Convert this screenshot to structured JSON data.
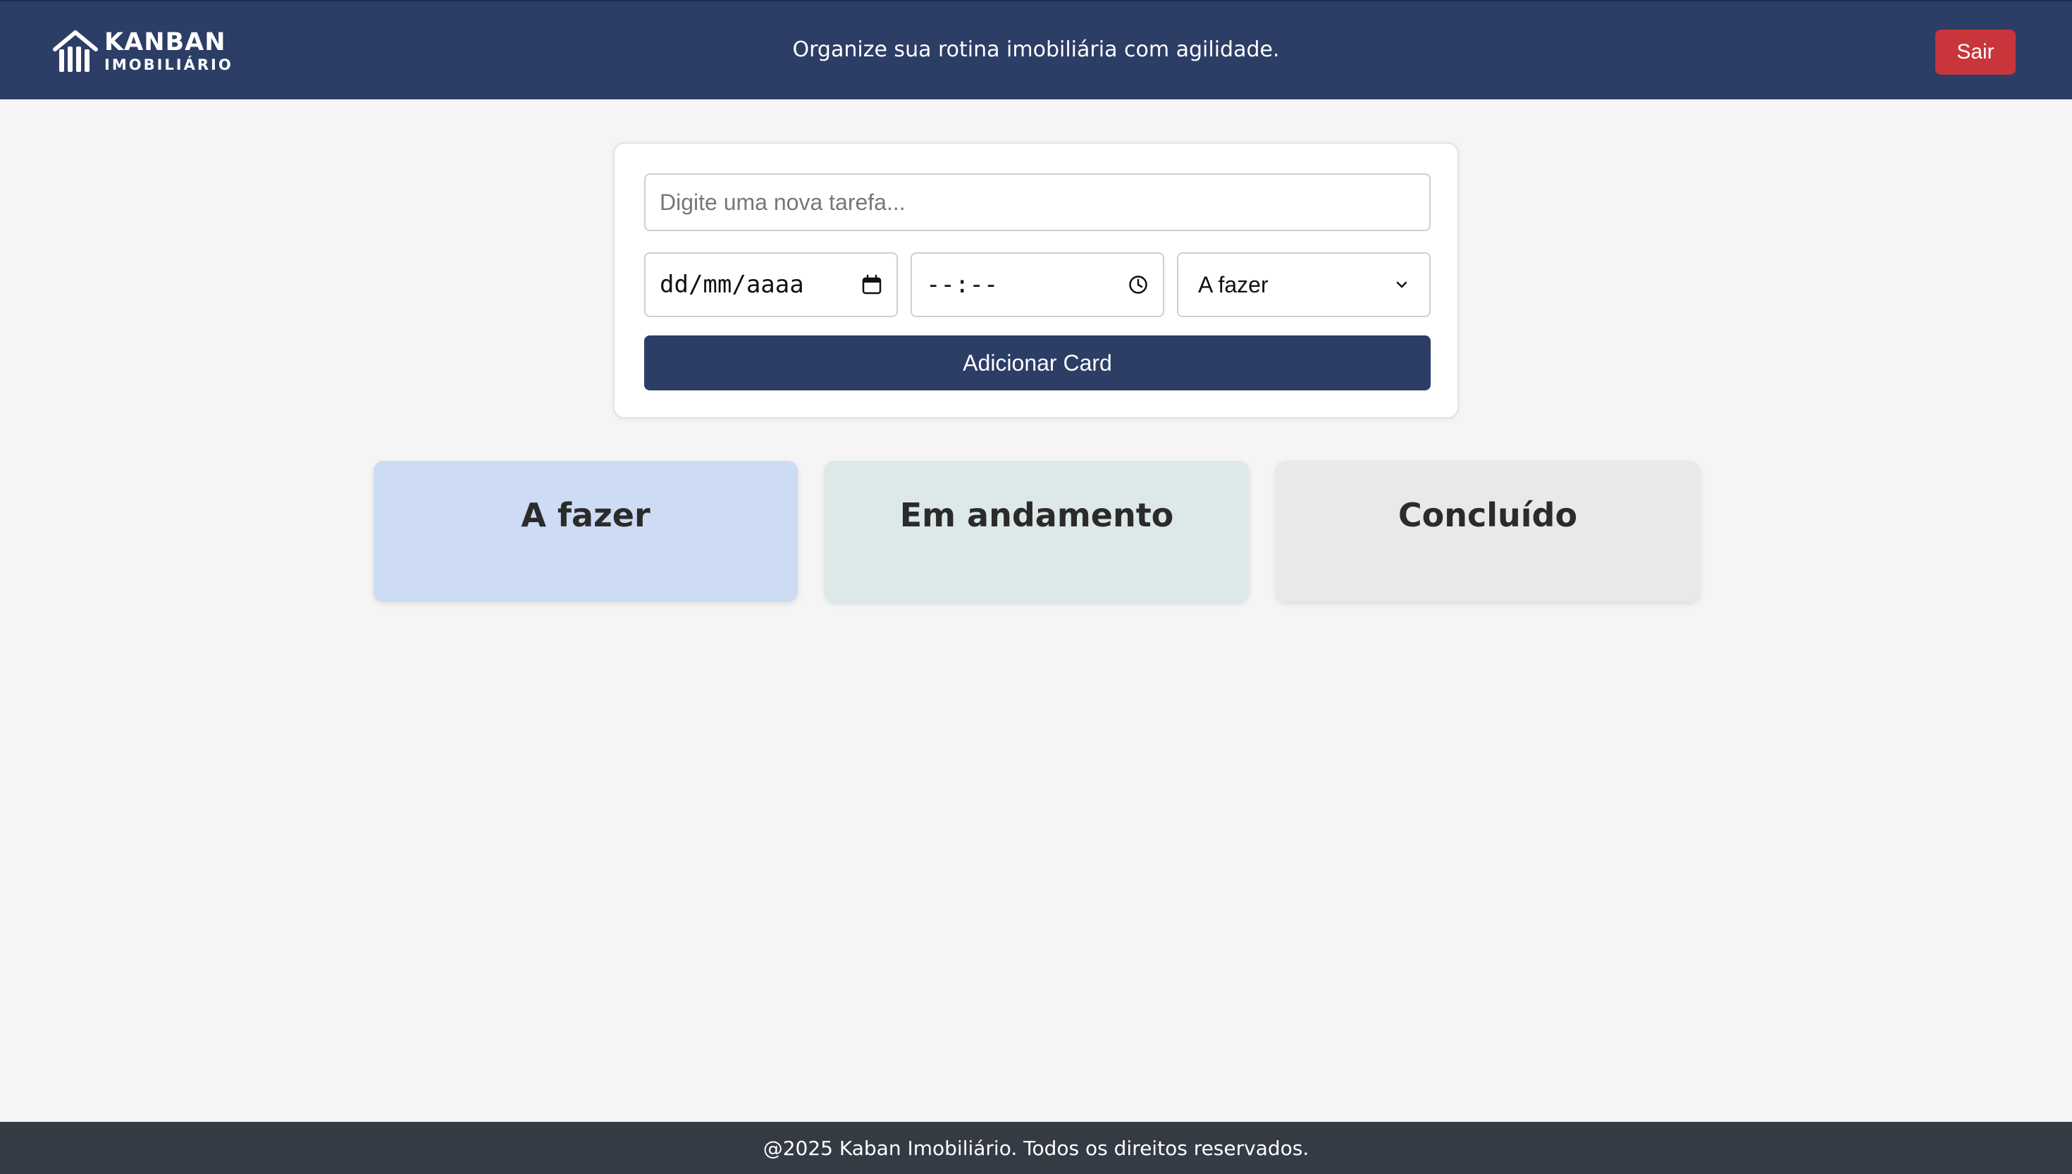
{
  "header": {
    "logo_main": "KANBAN",
    "logo_sub": "IMOBILIÁRIO",
    "logo_icon": "house-columns-icon",
    "tagline": "Organize sua rotina imobiliária com agilidade.",
    "logout_label": "Sair"
  },
  "form": {
    "task_placeholder": "Digite uma nova tarefa...",
    "task_value": "",
    "date_placeholder": "dd/mm/aaaa",
    "date_icon": "calendar-icon",
    "time_placeholder": "--:--",
    "time_icon": "clock-icon",
    "status_selected": "A fazer",
    "status_icon": "chevron-down-icon",
    "add_button_label": "Adicionar Card"
  },
  "columns": [
    {
      "title": "A fazer",
      "color": "#cddbf4"
    },
    {
      "title": "Em andamento",
      "color": "#dde8e8"
    },
    {
      "title": "Concluído",
      "color": "#e8e9eb"
    }
  ],
  "footer": {
    "text": "@2025 Kaban Imobiliário. Todos os direitos reservados."
  },
  "colors": {
    "primary": "#2c3d66",
    "danger": "#c9353a",
    "footer_bg": "#353b45",
    "page_bg": "#f5f5f5"
  }
}
